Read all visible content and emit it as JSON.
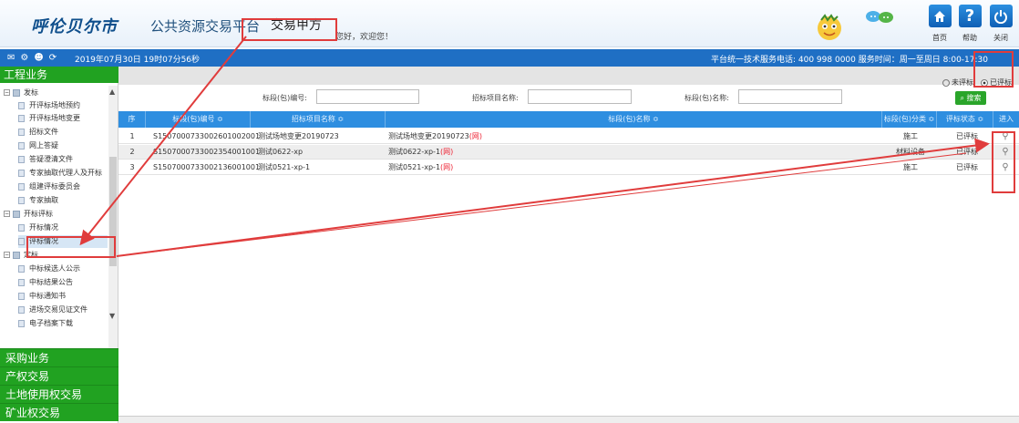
{
  "header": {
    "city": "呼伦贝尔市",
    "platform": "公共资源交易平台",
    "user": "交易甲方",
    "welcome": "您好，欢迎您！",
    "buttons": [
      {
        "label": "首页",
        "icon": "home-icon"
      },
      {
        "label": "帮助",
        "icon": "help-icon"
      },
      {
        "label": "关闭",
        "icon": "power-icon"
      }
    ]
  },
  "bluebar": {
    "date": "2019年07月30日 19时07分56秒",
    "hotline": "平台统一技术服务电话: 400 998 0000 服务时间：周一至周日 8:00-17:30"
  },
  "sidebar": {
    "section_title": "工程业务",
    "groups": [
      {
        "label": "发标",
        "items": [
          "开评标场地预约",
          "开评标场地变更",
          "招标文件",
          "网上答疑",
          "答疑澄清文件",
          "专家抽取代理人及开标",
          "组建评标委员会",
          "专家抽取"
        ]
      },
      {
        "label": "开标评标",
        "items": [
          "开标情况",
          "评标情况"
        ]
      },
      {
        "label": "定标",
        "items": [
          "中标候选人公示",
          "中标结果公告",
          "中标通知书",
          "进场交易见证文件",
          "电子档案下载"
        ]
      }
    ],
    "bottom_sections": [
      "采购业务",
      "产权交易",
      "土地使用权交易",
      "矿业权交易"
    ]
  },
  "filters": {
    "radio_unassessed": "未评标",
    "radio_assessed": "已评标",
    "label_code": "标段(包)编号:",
    "label_project": "招标项目名称:",
    "label_name": "标段(包)名称:",
    "search_label": "搜索"
  },
  "table": {
    "headers": [
      "序",
      "标段(包)编号 ≎",
      "招标项目名称 ≎",
      "标段(包)名称 ≎",
      "标段(包)分类 ≎",
      "评标状态 ≎",
      "进入"
    ],
    "rows": [
      {
        "no": "1",
        "code": "S1507000733002601002001",
        "project": "测试场地变更20190723",
        "name": "测试场地变更20190723",
        "tag": "(网)",
        "category": "施工",
        "status": "已评标"
      },
      {
        "no": "2",
        "code": "S1507000733002354001001",
        "project": "测试0622-xp",
        "name": "测试0622-xp-1",
        "tag": "(网)",
        "category": "材料设备",
        "status": "已评标"
      },
      {
        "no": "3",
        "code": "S1507000733002136001001",
        "project": "测试0521-xp-1",
        "name": "测试0521-xp-1",
        "tag": "(网)",
        "category": "施工",
        "status": "已评标"
      }
    ]
  },
  "colors": {
    "brand_blue": "#1f6fc4",
    "nav_green": "#21a221",
    "grid_header": "#2e8ee0",
    "annotation_red": "#e03c3c"
  }
}
